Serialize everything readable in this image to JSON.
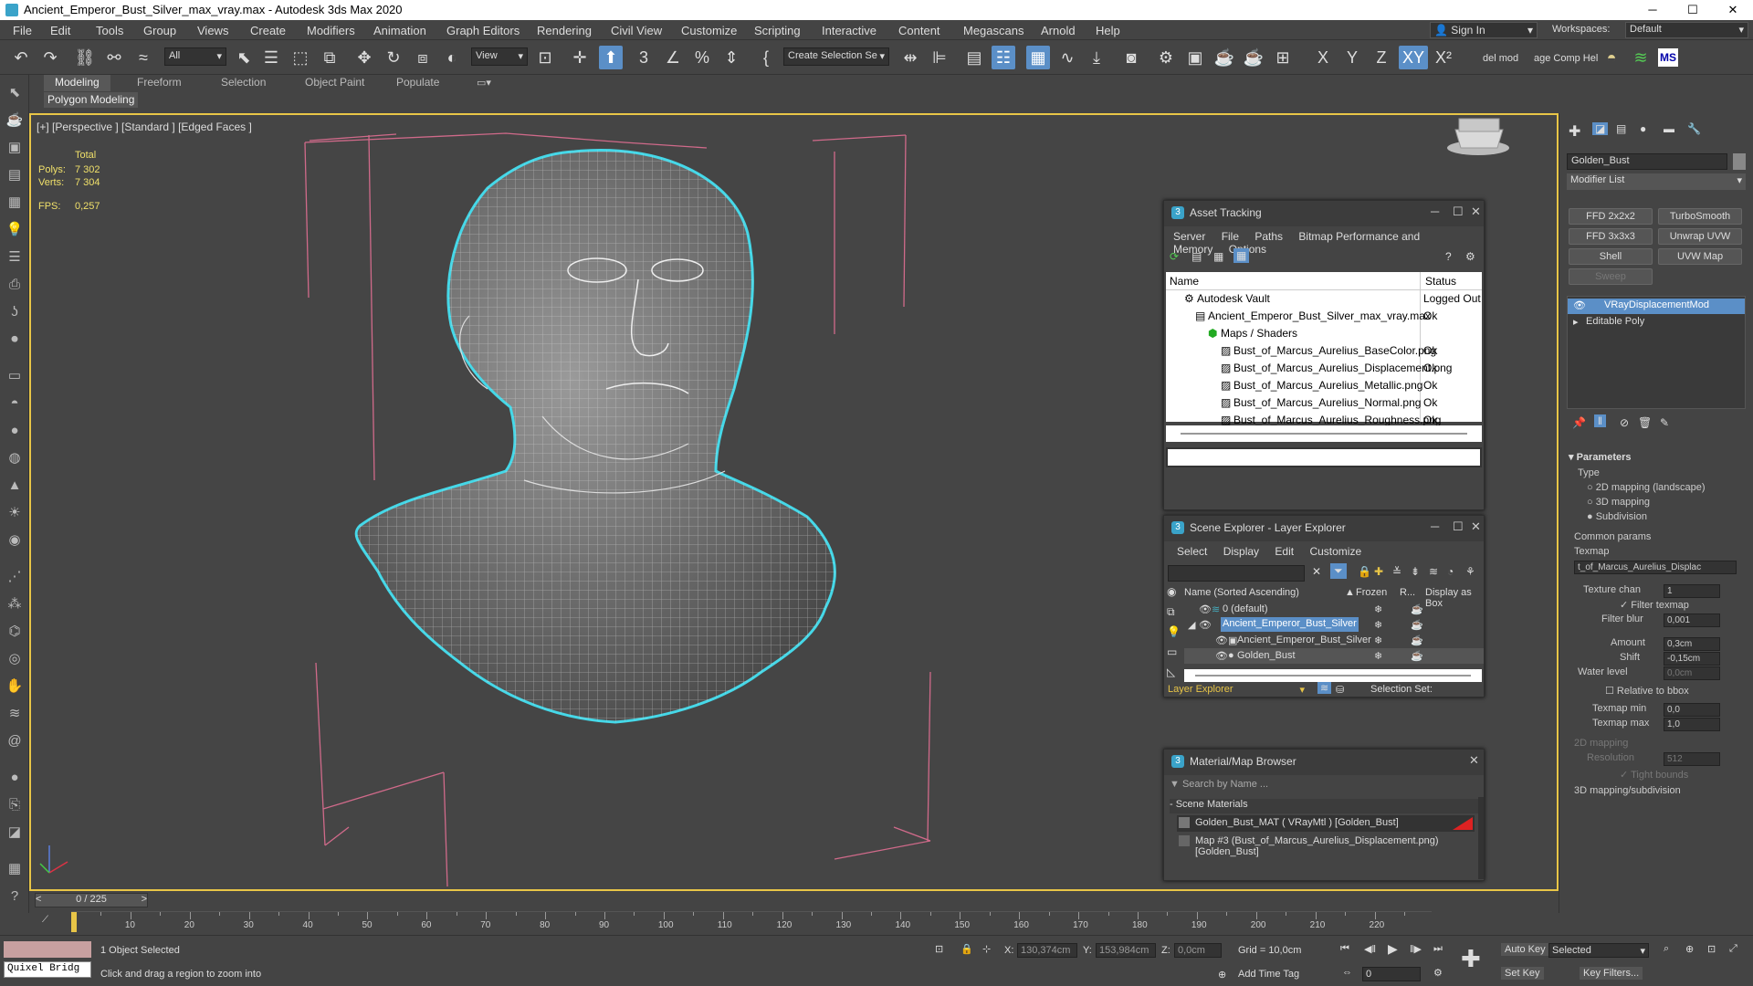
{
  "window": {
    "title": "Ancient_Emperor_Bust_Silver_max_vray.max - Autodesk 3ds Max 2020",
    "min": "─",
    "max": "☐",
    "close": "✕"
  },
  "menu": [
    "File",
    "Edit",
    "Tools",
    "Group",
    "Views",
    "Create",
    "Modifiers",
    "Animation",
    "Graph Editors",
    "Rendering",
    "Civil View",
    "Customize",
    "Scripting",
    "Interactive",
    "Content",
    "Megascans",
    "Arnold",
    "Help"
  ],
  "signin": "Sign In",
  "workspaces_label": "Workspaces:",
  "workspace": "Default",
  "toolbar": {
    "filter": "All",
    "view": "View",
    "selset": "Create Selection Se",
    "xyz": [
      "X",
      "Y",
      "Z",
      "XY"
    ],
    "delmod": "del mod",
    "compheli": "age Comp Hel",
    "ms": "MS"
  },
  "ribbon": {
    "tabs": [
      "Modeling",
      "Freeform",
      "Selection",
      "Object Paint",
      "Populate"
    ],
    "sub": "Polygon Modeling"
  },
  "viewport": {
    "label": "[+] [Perspective ] [Standard ] [Edged Faces ]",
    "total": "Total",
    "polys_label": "Polys:",
    "polys": "7 302",
    "verts_label": "Verts:",
    "verts": "7 304",
    "fps_label": "FPS:",
    "fps": "0,257"
  },
  "asset": {
    "title": "Asset Tracking",
    "menu": [
      "Server",
      "File",
      "Paths",
      "Bitmap Performance and Memory",
      "Options"
    ],
    "col_name": "Name",
    "col_status": "Status",
    "rows": [
      {
        "name": "Autodesk Vault",
        "status": "Logged Out"
      },
      {
        "name": "Ancient_Emperor_Bust_Silver_max_vray.max",
        "status": "Ok"
      },
      {
        "name": "Maps / Shaders",
        "status": ""
      },
      {
        "name": "Bust_of_Marcus_Aurelius_BaseColor.png",
        "status": "Ok"
      },
      {
        "name": "Bust_of_Marcus_Aurelius_Displacement.png",
        "status": "Ok"
      },
      {
        "name": "Bust_of_Marcus_Aurelius_Metallic.png",
        "status": "Ok"
      },
      {
        "name": "Bust_of_Marcus_Aurelius_Normal.png",
        "status": "Ok"
      },
      {
        "name": "Bust_of_Marcus_Aurelius_Roughness.png",
        "status": "Ok"
      }
    ]
  },
  "scene": {
    "title": "Scene Explorer - Layer Explorer",
    "menu": [
      "Select",
      "Display",
      "Edit",
      "Customize"
    ],
    "col_name": "Name (Sorted Ascending)",
    "col_frozen": "Frozen",
    "col_r": "R...",
    "col_box": "Display as Box",
    "rows": [
      {
        "name": "0 (default)"
      },
      {
        "name": "Ancient_Emperor_Bust_Silver"
      },
      {
        "name": "Ancient_Emperor_Bust_Silver"
      },
      {
        "name": "Golden_Bust"
      }
    ],
    "footer": "Layer Explorer",
    "selset": "Selection Set:"
  },
  "matbrowser": {
    "title": "Material/Map Browser",
    "search": "Search by Name ...",
    "section": "- Scene Materials",
    "items": [
      "Golden_Bust_MAT ( VRayMtl ) [Golden_Bust]",
      "Map #3 (Bust_of_Marcus_Aurelius_Displacement.png) [Golden_Bust]"
    ]
  },
  "cmd": {
    "objname": "Golden_Bust",
    "modlist": "Modifier List",
    "buttons": [
      "FFD 2x2x2",
      "TurboSmooth",
      "FFD 3x3x3",
      "Unwrap UVW",
      "Shell",
      "UVW Map",
      "Sweep"
    ],
    "stack": [
      "VRayDisplacementMod",
      "Editable Poly"
    ],
    "params": {
      "header": "Parameters",
      "type": "Type",
      "opt1": "2D mapping (landscape)",
      "opt2": "3D mapping",
      "opt3": "Subdivision",
      "common": "Common params",
      "texmap": "Texmap",
      "texmap_val": "t_of_Marcus_Aurelius_Displac",
      "texchan": "Texture chan",
      "texchan_val": "1",
      "filter": "Filter texmap",
      "fblur": "Filter blur",
      "fblur_val": "0,001",
      "amount": "Amount",
      "amount_val": "0,3cm",
      "shift": "Shift",
      "shift_val": "-0,15cm",
      "water": "Water level",
      "water_val": "0,0cm",
      "relbbox": "Relative to bbox",
      "tmin": "Texmap min",
      "tmin_val": "0,0",
      "tmax": "Texmap max",
      "tmax_val": "1,0",
      "map2d": "2D mapping",
      "res": "Resolution",
      "res_val": "512",
      "tight": "Tight bounds",
      "map3d": "3D mapping/subdivision"
    }
  },
  "timeline": {
    "frame": "0 / 225",
    "ticks": [
      "10",
      "20",
      "30",
      "40",
      "50",
      "60",
      "70",
      "80",
      "90",
      "100",
      "110",
      "120",
      "130",
      "140",
      "150",
      "160",
      "170",
      "180",
      "190",
      "200",
      "210",
      "220"
    ]
  },
  "status": {
    "quixel": "Quixel Bridg",
    "selected": "1 Object Selected",
    "hint": "Click and drag a region to zoom into",
    "x_label": "X:",
    "x": "130,374cm",
    "y_label": "Y:",
    "y": "153,984cm",
    "z_label": "Z:",
    "z": "0,0cm",
    "grid": "Grid = 10,0cm",
    "addtime": "Add Time Tag",
    "autokey": "Auto Key",
    "setkey": "Set Key",
    "selected_dd": "Selected",
    "keyfilters": "Key Filters...",
    "frame_in": "0"
  }
}
